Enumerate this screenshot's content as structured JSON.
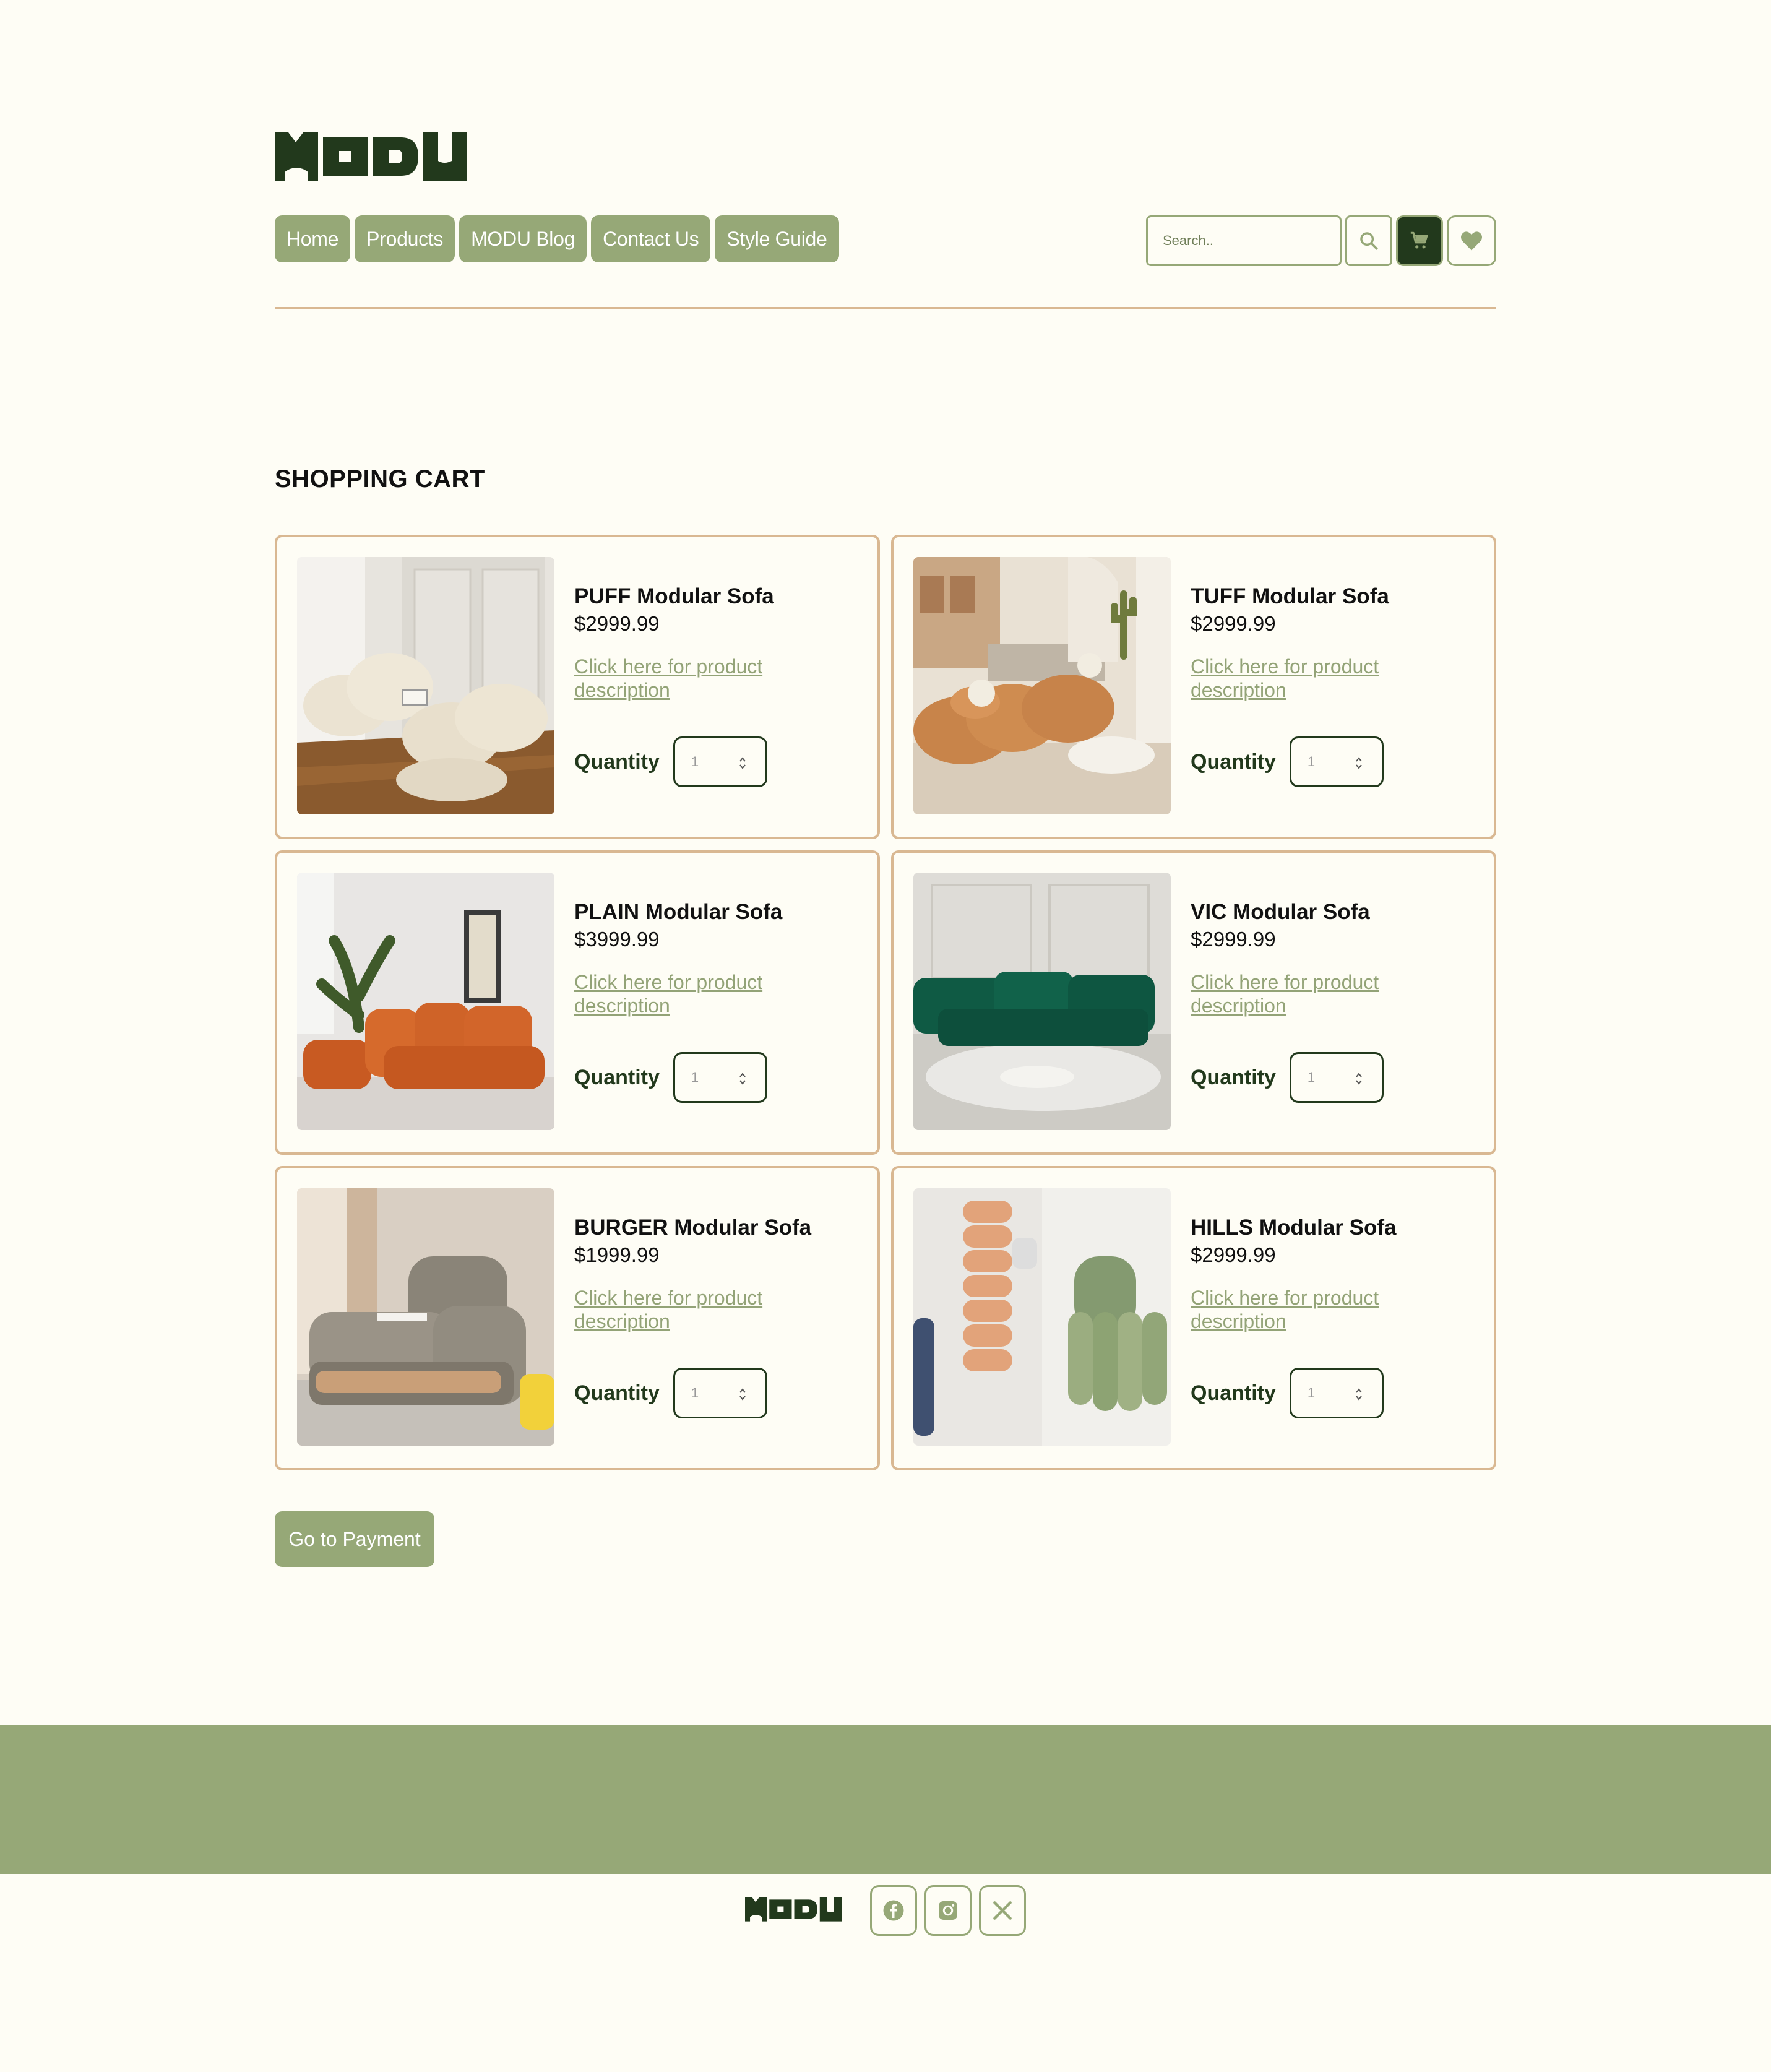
{
  "brand": {
    "logo_text": "MODU"
  },
  "nav": {
    "items": [
      {
        "label": "Home"
      },
      {
        "label": "Products"
      },
      {
        "label": "MODU Blog"
      },
      {
        "label": "Contact Us"
      },
      {
        "label": "Style Guide"
      }
    ]
  },
  "search": {
    "placeholder": "Search.."
  },
  "icons": {
    "search": "search-icon",
    "cart": "cart-icon",
    "heart": "heart-icon",
    "facebook": "facebook-icon",
    "instagram": "instagram-icon",
    "x": "x-icon"
  },
  "colors": {
    "accent": "#96a877",
    "dark_green": "#22391c",
    "border_tan": "#d9b892",
    "background": "#fefdf5"
  },
  "page": {
    "title": "SHOPPING CART"
  },
  "cart": {
    "link_text": "Click here for product description",
    "quantity_label": "Quantity",
    "items": [
      {
        "name": "PUFF Modular Sofa",
        "price": "$2999.99",
        "quantity": "1",
        "image": "cream-boucle-sofa"
      },
      {
        "name": "TUFF Modular Sofa",
        "price": "$2999.99",
        "quantity": "1",
        "image": "tan-sofa-living-room"
      },
      {
        "name": "PLAIN Modular Sofa",
        "price": "$3999.99",
        "quantity": "1",
        "image": "orange-sectional-sofa"
      },
      {
        "name": "VIC Modular Sofa",
        "price": "$2999.99",
        "quantity": "1",
        "image": "green-velvet-sectional"
      },
      {
        "name": "BURGER Modular Sofa",
        "price": "$1999.99",
        "quantity": "1",
        "image": "gray-armchair"
      },
      {
        "name": "HILLS Modular Sofa",
        "price": "$2999.99",
        "quantity": "1",
        "image": "ribbed-modular-chairs"
      }
    ]
  },
  "payment": {
    "button_label": "Go to Payment"
  },
  "footer": {
    "logo_text": "MODU"
  }
}
